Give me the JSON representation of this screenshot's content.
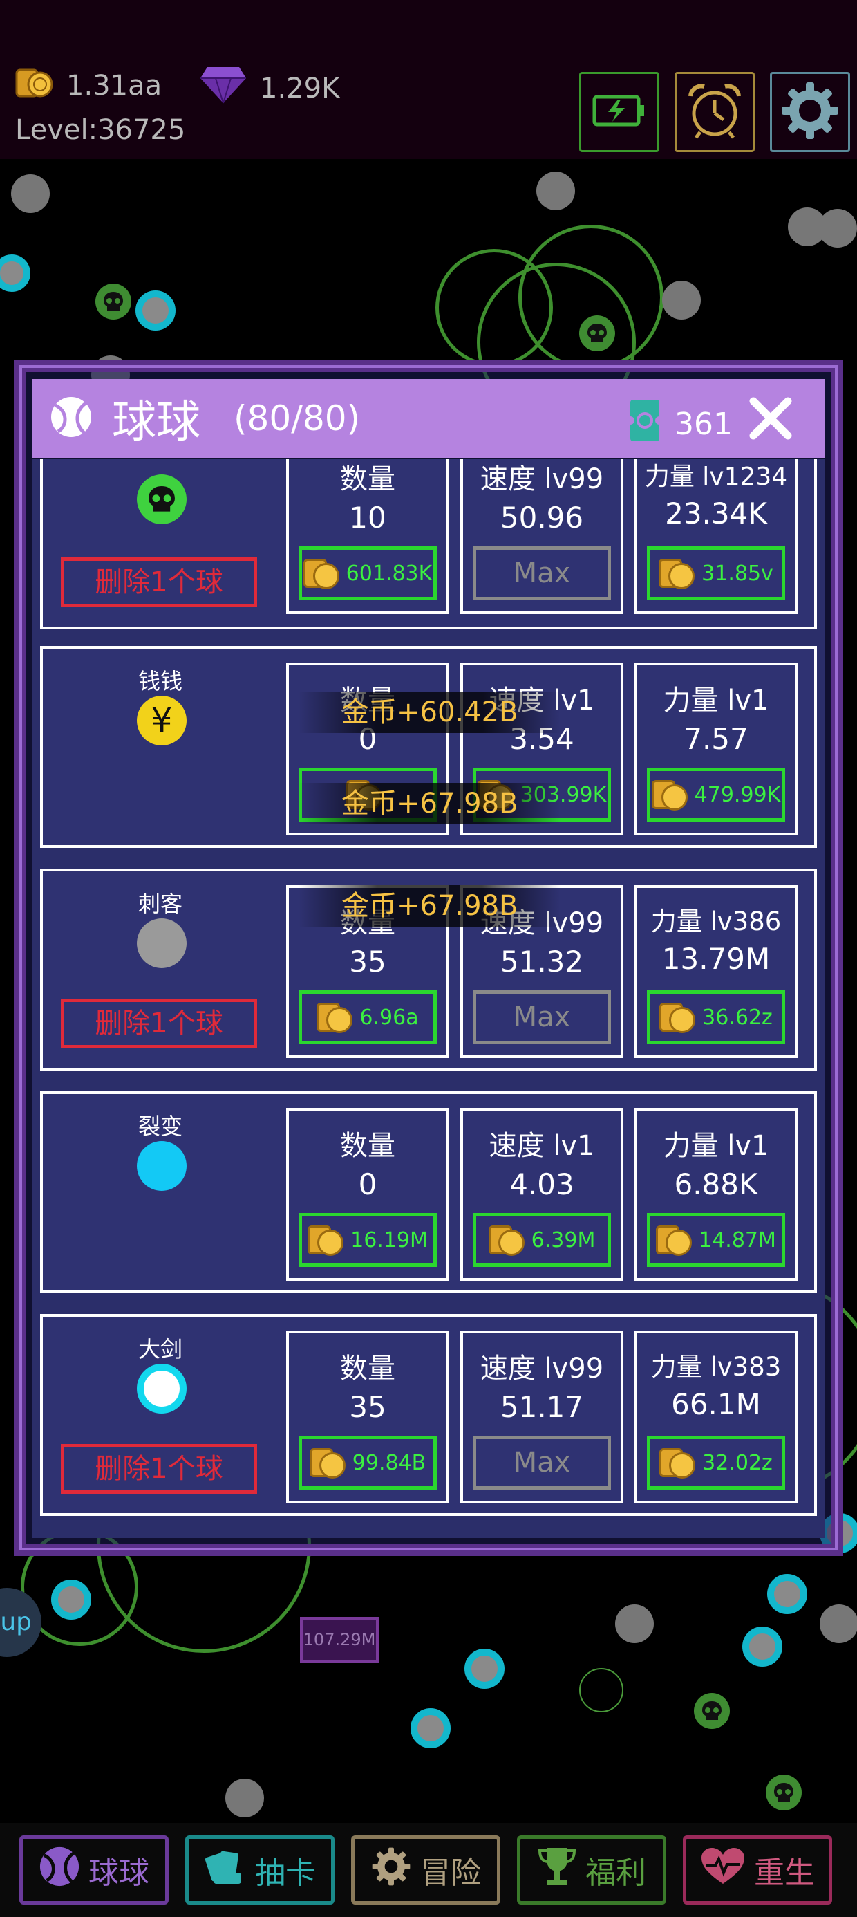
{
  "header": {
    "gold": "1.31aa",
    "diamonds": "1.29K",
    "level": "Level:36725",
    "buttons": [
      "battery-button",
      "alarm-clock-button",
      "settings-button"
    ]
  },
  "panel": {
    "title": "球球",
    "count": "(80/80)",
    "tickets": "361"
  },
  "rows": [
    {
      "name": "",
      "delete": "删除1个球",
      "qty_label": "数量",
      "qty_value": "10",
      "qty_cost": "601.83K",
      "spd_label": "速度 lv99",
      "spd_value": "50.96",
      "spd_cost": "Max",
      "pow_label": "力量 lv1234",
      "pow_value": "23.34K",
      "pow_cost": "31.85v"
    },
    {
      "name": "钱钱",
      "delete": "",
      "qty_label": "数量",
      "qty_value": "0",
      "qty_cost": "",
      "spd_label": "速度 lv1",
      "spd_value": "3.54",
      "spd_cost": "303.99K",
      "pow_label": "力量 lv1",
      "pow_value": "7.57",
      "pow_cost": "479.99K"
    },
    {
      "name": "刺客",
      "delete": "删除1个球",
      "qty_label": "数量",
      "qty_value": "35",
      "qty_cost": "6.96a",
      "spd_label": "速度 lv99",
      "spd_value": "51.32",
      "spd_cost": "Max",
      "pow_label": "力量 lv386",
      "pow_value": "13.79M",
      "pow_cost": "36.62z"
    },
    {
      "name": "裂变",
      "delete": "",
      "qty_label": "数量",
      "qty_value": "0",
      "qty_cost": "16.19M",
      "spd_label": "速度 lv1",
      "spd_value": "4.03",
      "spd_cost": "6.39M",
      "pow_label": "力量 lv1",
      "pow_value": "6.88K",
      "pow_cost": "14.87M"
    },
    {
      "name": "大剑",
      "delete": "删除1个球",
      "qty_label": "数量",
      "qty_value": "35",
      "qty_cost": "99.84B",
      "spd_label": "速度 lv99",
      "spd_value": "51.17",
      "spd_cost": "Max",
      "pow_label": "力量 lv383",
      "pow_value": "66.1M",
      "pow_cost": "32.02z"
    }
  ],
  "floating_texts": [
    "金币+60.42B",
    "金币+67.98B",
    "金币+67.98B"
  ],
  "field": {
    "brick_value": "107.29M",
    "side_button": "up"
  },
  "nav": [
    "球球",
    "抽卡",
    "冒险",
    "福利",
    "重生"
  ],
  "colors": {
    "panel_header": "#b583e0",
    "buy_border": "#2bd72f",
    "delete_red": "#e02a3a",
    "float_text": "#f6c244"
  }
}
